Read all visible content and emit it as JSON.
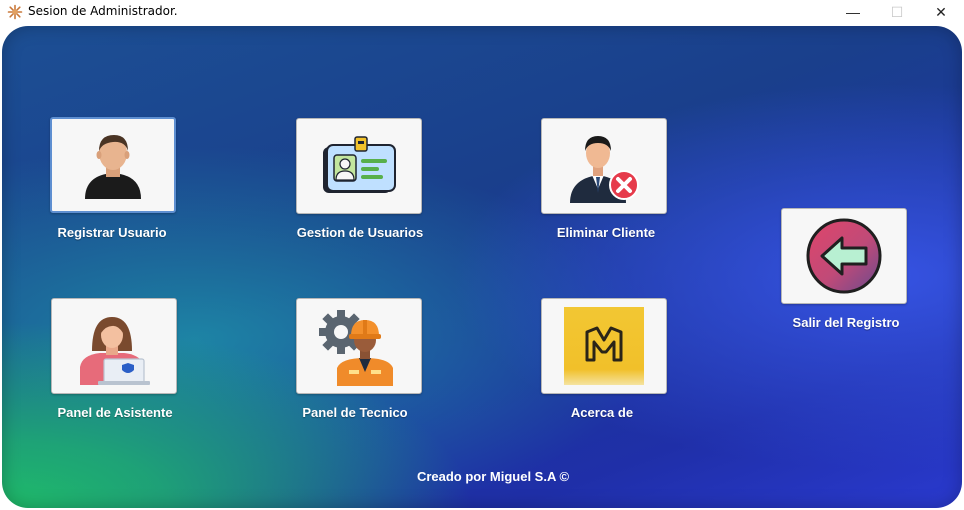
{
  "window": {
    "title": "Sesion de Administrador.",
    "controls": {
      "minimize": "—",
      "maximize": "☐",
      "close": "✕"
    }
  },
  "tiles": [
    {
      "label": "Registrar Usuario",
      "icon": "user-silhouette-icon"
    },
    {
      "label": "Gestion de Usuarios",
      "icon": "id-card-icon"
    },
    {
      "label": "Eliminar Cliente",
      "icon": "businessman-delete-icon"
    },
    {
      "label": "Panel de Asistente",
      "icon": "assistant-laptop-icon"
    },
    {
      "label": "Panel de Tecnico",
      "icon": "technician-gear-icon"
    },
    {
      "label": "Acerca de",
      "icon": "m-logo-icon"
    },
    {
      "label": "Salir del Registro",
      "icon": "back-arrow-icon"
    }
  ],
  "footer": "Creado por Miguel S.A ©",
  "colors": {
    "background_green": "#1fbd6a",
    "background_blue": "#1f2fa8",
    "tile_background": "#f7f7f7",
    "selected_border": "#5e8fd1",
    "label_text": "#ffffff"
  }
}
